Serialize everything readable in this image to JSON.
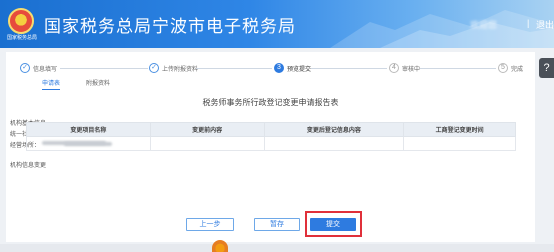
{
  "header": {
    "logo_caption": "国家税务总局",
    "title": "国家税务总局宁波市电子税务局",
    "user_name": "欢迎您",
    "separator": "|",
    "logout": "退出"
  },
  "help": {
    "label": "?"
  },
  "steps": [
    {
      "num": "✓",
      "label": "信息填写"
    },
    {
      "num": "✓",
      "label": "上传附报资料"
    },
    {
      "num": "3",
      "label": "预览提交"
    },
    {
      "num": "4",
      "label": "审核中"
    },
    {
      "num": "5",
      "label": "完成"
    }
  ],
  "sub_tabs": [
    "申请表",
    "附报资料"
  ],
  "form": {
    "title": "税务师事务所行政登记变更申请报告表",
    "basic_info_heading": "机构基本信息",
    "credit_code_label": "统一社会信用代码：",
    "firm_name_label": "税务师事务所名称：",
    "business_place_label": "经营场所：",
    "change_info_heading": "机构信息变更"
  },
  "table": {
    "headers": [
      "变更项目名称",
      "变更前内容",
      "变更后登记信息内容",
      "工商登记变更时间"
    ]
  },
  "buttons": {
    "prev": "上一步",
    "save": "暂存",
    "submit": "提交"
  }
}
